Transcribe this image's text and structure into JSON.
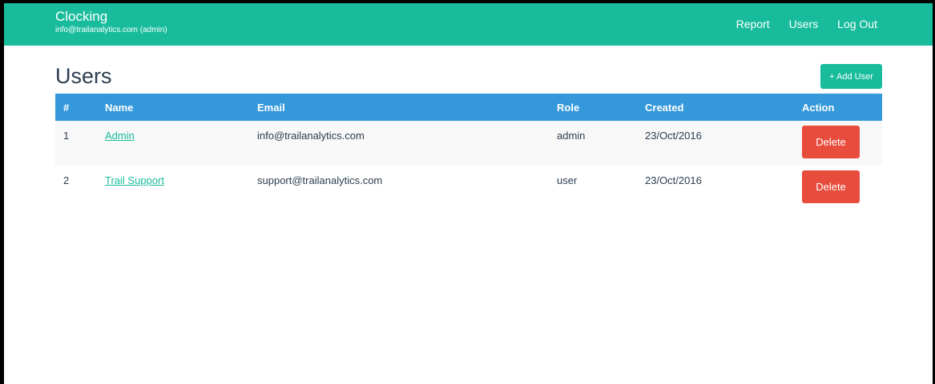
{
  "navbar": {
    "brand_title": "Clocking",
    "brand_subtitle": "info@trailanalytics.com (admin)",
    "links": [
      "Report",
      "Users",
      "Log Out"
    ],
    "background": "#18bc9c"
  },
  "page": {
    "title": "Users",
    "add_button_label": "+ Add User"
  },
  "table": {
    "headers": [
      "#",
      "Name",
      "Email",
      "Role",
      "Created",
      "Action"
    ],
    "header_background": "#3498db",
    "rows": [
      {
        "num": "1",
        "name": "Admin",
        "email": "info@trailanalytics.com",
        "role": "admin",
        "created": "23/Oct/2016",
        "action": "Delete"
      },
      {
        "num": "2",
        "name": "Trail Support",
        "email": "support@trailanalytics.com",
        "role": "user",
        "created": "23/Oct/2016",
        "action": "Delete"
      }
    ]
  },
  "colors": {
    "accent": "#18bc9c",
    "danger": "#e74c3c",
    "text": "#2c3e50"
  }
}
